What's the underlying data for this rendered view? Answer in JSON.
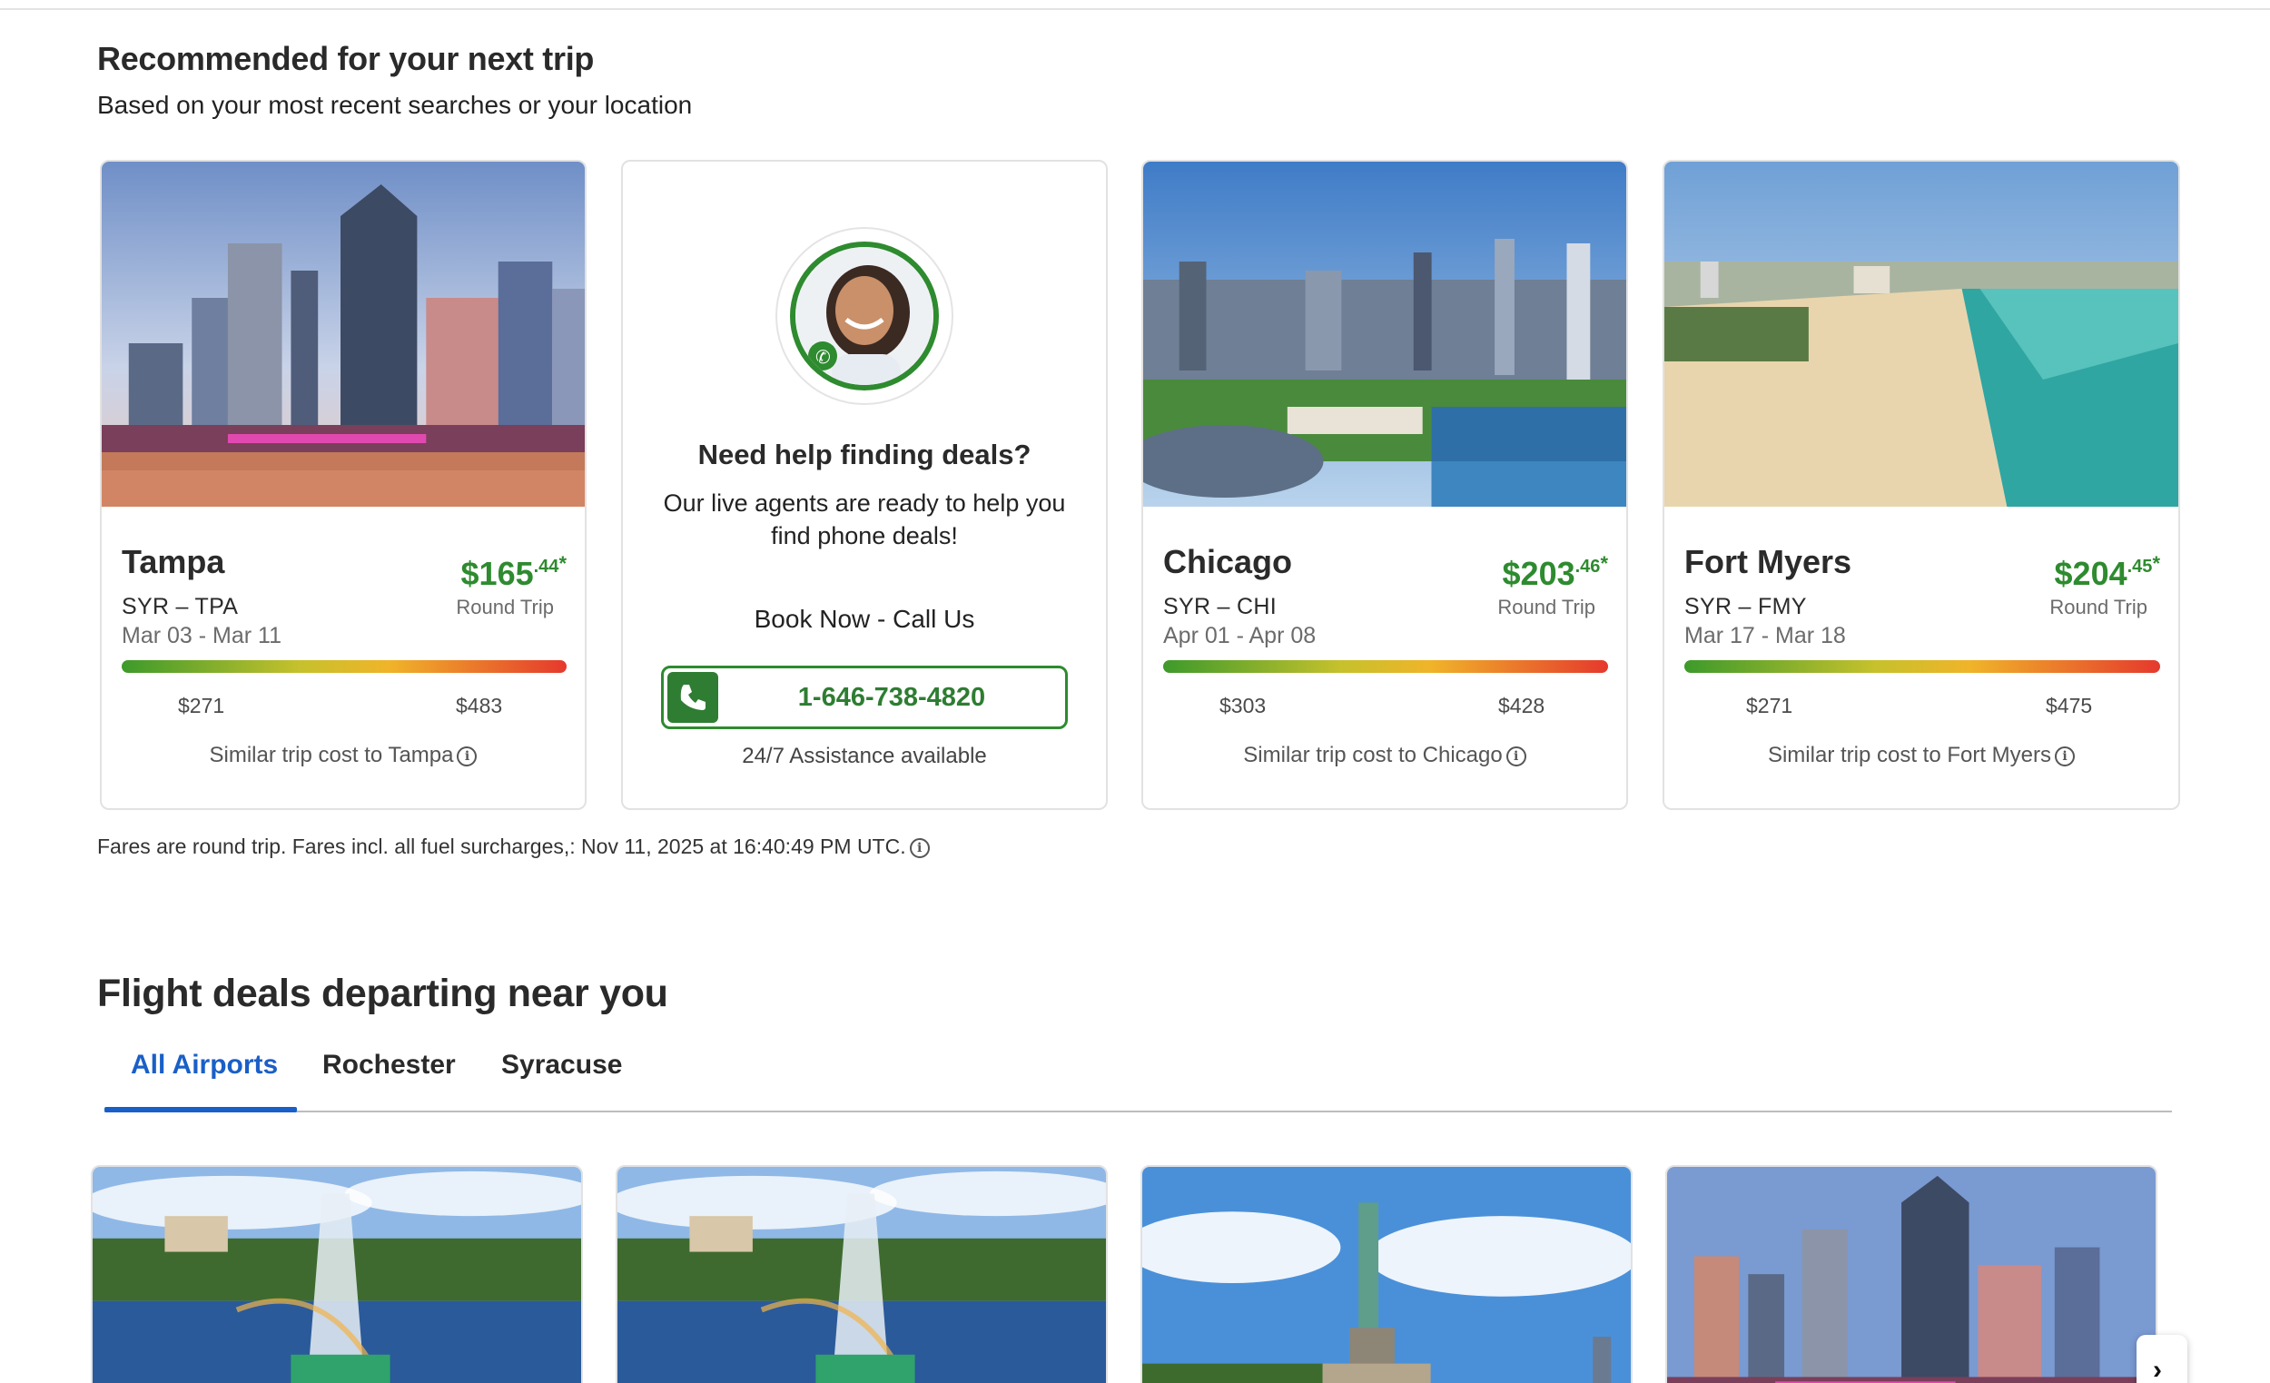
{
  "recommended": {
    "title": "Recommended for your next trip",
    "subtitle": "Based on your most recent searches or your location",
    "cards": [
      {
        "city": "Tampa",
        "route": "SYR – TPA",
        "dates": "Mar 03 - Mar 11",
        "price_dollars": "$165",
        "price_cents": ".44",
        "price_mark": "*",
        "trip_type": "Round Trip",
        "range_low": "$271",
        "range_high": "$483",
        "similar": "Similar trip cost to Tampa",
        "image": "tampa-skyline"
      },
      {
        "city": "Chicago",
        "route": "SYR – CHI",
        "dates": "Apr 01 - Apr 08",
        "price_dollars": "$203",
        "price_cents": ".46",
        "price_mark": "*",
        "trip_type": "Round Trip",
        "range_low": "$303",
        "range_high": "$428",
        "similar": "Similar trip cost to Chicago",
        "image": "chicago-skyline"
      },
      {
        "city": "Fort Myers",
        "route": "SYR – FMY",
        "dates": "Mar 17 - Mar 18",
        "price_dollars": "$204",
        "price_cents": ".45",
        "price_mark": "*",
        "trip_type": "Round Trip",
        "range_low": "$271",
        "range_high": "$475",
        "similar": "Similar trip cost to Fort Myers",
        "image": "fort-myers-beach"
      }
    ],
    "agent": {
      "title": "Need help finding deals?",
      "text": "Our live agents are ready to help you find phone deals!",
      "book": "Book Now - Call Us",
      "phone": "1-646-738-4820",
      "assist": "24/7 Assistance available"
    },
    "disclaimer": "Fares are round trip. Fares incl. all fuel surcharges,: Nov 11, 2025 at 16:40:49 PM UTC."
  },
  "deals": {
    "title": "Flight deals departing near you",
    "tabs": [
      "All Airports",
      "Rochester",
      "Syracuse"
    ],
    "active_tab": "All Airports",
    "cards": [
      "orlando-fountain",
      "orlando-fountain",
      "statue-of-liberty",
      "tampa-skyline"
    ]
  },
  "icons": {
    "info": "info-icon",
    "phone": "phone-icon",
    "next": "chevron-right-icon"
  },
  "colors": {
    "price_green": "#2e8b2f",
    "tab_blue": "#1a5fc7",
    "bar_low": "#3d9a2b",
    "bar_high": "#e5392d"
  }
}
